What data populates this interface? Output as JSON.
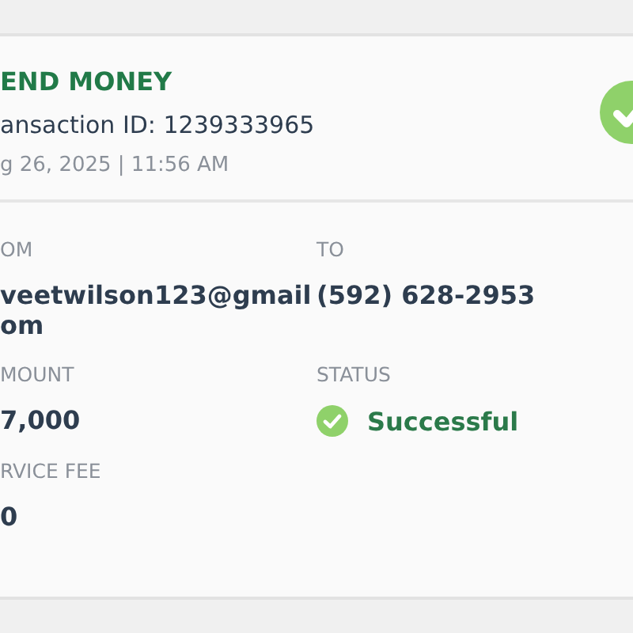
{
  "header": {
    "title": "END MONEY",
    "transaction_id": "ansaction ID: 1239333965",
    "datetime": "g 26, 2025 | 11:56 AM"
  },
  "details": [
    {
      "kind": "text",
      "label": "OM",
      "value": "veetwilson123@gmail\nom"
    },
    {
      "kind": "text",
      "label": "TO",
      "value": "(592) 628-2953"
    },
    {
      "kind": "text",
      "label": "MOUNT",
      "value": "7,000"
    },
    {
      "kind": "status",
      "label": "STATUS",
      "value": "Successful"
    },
    {
      "kind": "text",
      "label": "RVICE FEE",
      "value": "0"
    }
  ]
}
